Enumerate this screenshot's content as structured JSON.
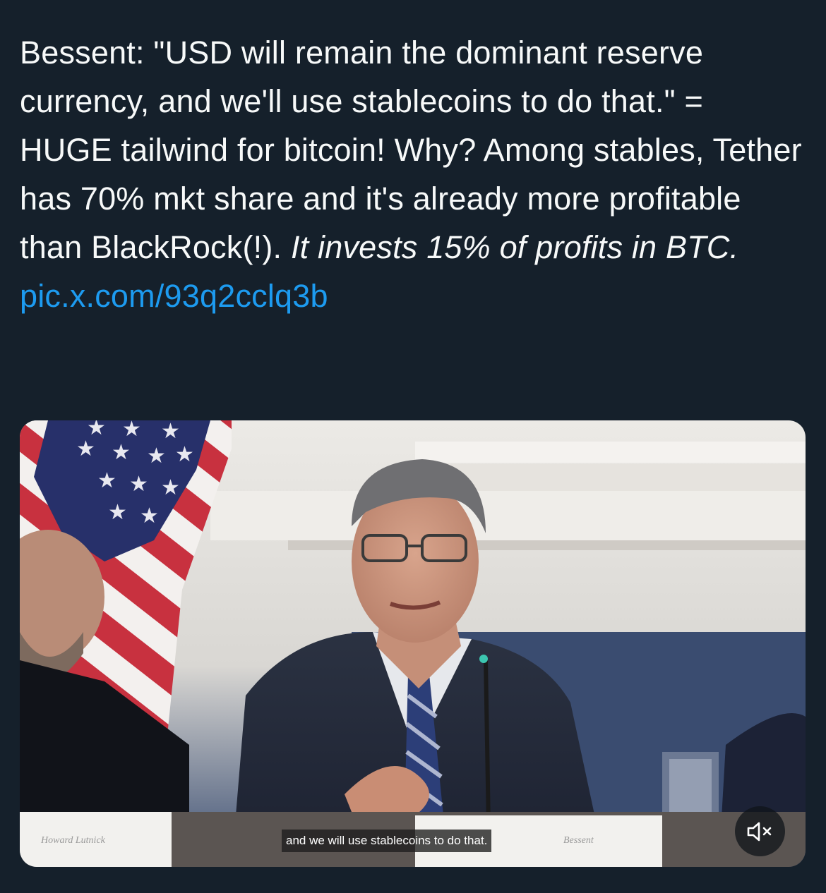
{
  "tweet": {
    "text_plain": "Bessent: \"USD will remain the dominant reserve currency, and we'll use stablecoins to do that.\" = HUGE tailwind for bitcoin! Why? Among stables, Tether has 70% mkt share and it's already more profitable than BlackRock(!). ",
    "text_italic": "It invests 15% of profits in BTC.",
    "link_text": "pic.x.com/93q2cclq3b",
    "link_color": "#1d9bf0"
  },
  "media": {
    "caption": "and we will use stablecoins to do that.",
    "mute_icon": "speaker-muted-icon",
    "nameplate_left": "Howard Lutnick",
    "nameplate_right": "Bessent"
  },
  "colors": {
    "background": "#15202b",
    "text": "#f7f9f9"
  }
}
